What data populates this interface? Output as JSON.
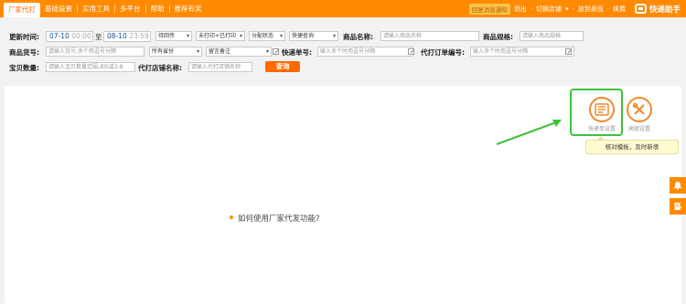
{
  "nav": {
    "tabs": [
      "厂家代打",
      "基础设置",
      "实用工具",
      "多平台",
      "帮助",
      "推荐有奖"
    ],
    "shop_badge": "回复消息通知",
    "logout": "退出",
    "switch_shop": "切换店铺",
    "desktop": "放到桌面",
    "renew": "续费",
    "brand": "快递助手"
  },
  "filters": {
    "update_time_label": "更新时间:",
    "start_date": "07-10",
    "start_time": "00:00",
    "to": "至",
    "end_date": "08-10",
    "end_time": "23:59",
    "status_select": "待回传",
    "print_select": "未打印+已打印",
    "assign_select": "分配状态",
    "quick_query_select": "快捷查询",
    "product_name_label": "商品名称:",
    "product_name_placeholder": "请输入商品名称",
    "product_spec_label": "商品规格:",
    "product_spec_placeholder": "请输入商品规格",
    "product_code_label": "商品货号:",
    "product_code_placeholder": "请输入货号,多个用逗号分隔",
    "province_select": "所有省份",
    "remark_select": "留言备注",
    "express_no_label": "快递单号:",
    "express_no_placeholder": "输入多个时用逗号分隔",
    "order_no_label": "代打订单编号:",
    "order_no_placeholder": "输入多个时用逗号分隔",
    "quantity_label": "宝贝数量:",
    "quantity_placeholder": "请输入宝贝数量范围,如5或3-8",
    "shop_name_label": "代打店铺名称:",
    "shop_name_placeholder": "请输入代打店铺名称",
    "query_button": "查询"
  },
  "main": {
    "quick_settings_label": "快递单设置",
    "advanced_settings_label": "高级设置",
    "tip": "核对模板，及时新增",
    "howto": "如何使用厂家代发功能?"
  },
  "colors": {
    "accent": "#ff8a00",
    "highlight": "#3ec23a"
  },
  "icons": [
    "express-template-icon",
    "wrench-screwdriver-icon",
    "bell-icon",
    "edit-note-icon",
    "pencil-icon",
    "brand-logo-icon"
  ]
}
